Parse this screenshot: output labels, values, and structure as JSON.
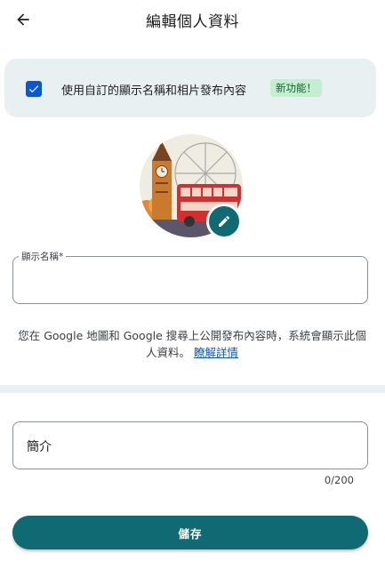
{
  "header": {
    "title": "編輯個人資料",
    "back_icon": "arrow-left-icon"
  },
  "notice": {
    "checkbox_checked": true,
    "text": "使用自訂的顯示名稱和相片發布內容",
    "badge": "新功能！",
    "badge_color": "#c4eed0"
  },
  "avatar": {
    "edit_icon": "pencil-icon",
    "image_subject": "london-illustration"
  },
  "display_name": {
    "label": "顯示名稱*",
    "value": ""
  },
  "help": {
    "text": "您在 Google 地圖和 Google 搜尋上公開發布內容時，系統會顯示此個人資料。",
    "link": "瞭解詳情"
  },
  "bio": {
    "placeholder": "簡介",
    "counter": "0/200"
  },
  "save": {
    "label": "儲存"
  },
  "colors": {
    "accent": "#0f6a73",
    "checkbox": "#0b57d0",
    "notice_bg": "#e9f0f2"
  }
}
